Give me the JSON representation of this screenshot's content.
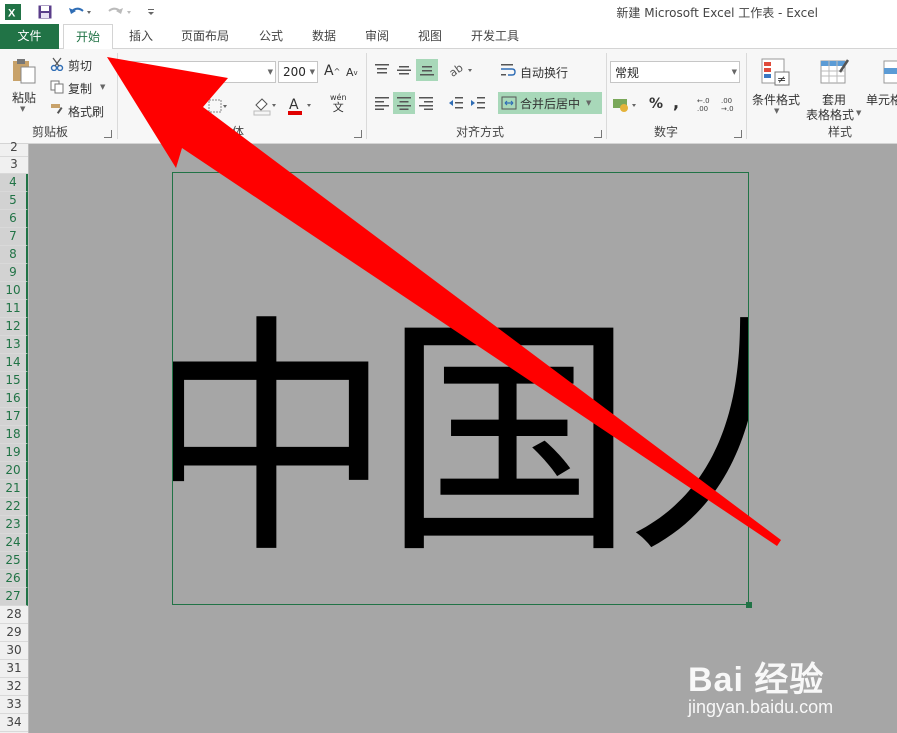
{
  "app": {
    "title": "新建 Microsoft Excel 工作表 - Excel",
    "brand_color": "#217346"
  },
  "tabs": [
    {
      "label": "文件"
    },
    {
      "label": "开始"
    },
    {
      "label": "插入"
    },
    {
      "label": "页面布局"
    },
    {
      "label": "公式"
    },
    {
      "label": "数据"
    },
    {
      "label": "审阅"
    },
    {
      "label": "视图"
    },
    {
      "label": "开发工具"
    }
  ],
  "clipboard": {
    "paste": "粘贴",
    "cut": "剪切",
    "copy": "复制",
    "format_painter": "格式刷",
    "group_label": "剪贴板"
  },
  "font": {
    "size": "200",
    "grow": "A",
    "shrink": "A",
    "phonetic": "wén",
    "phonetic_char": "文",
    "group_label_partial": "体"
  },
  "alignment": {
    "wrap_text": "自动换行",
    "merge_center": "合并后居中",
    "group_label": "对齐方式"
  },
  "number": {
    "format": "常规",
    "percent": "%",
    "comma": ",",
    "group_label": "数字"
  },
  "styles": {
    "conditional": "条件格式",
    "table_line1": "套用",
    "table_line2": "表格格式",
    "cell_partial": "单元格",
    "group_label": "样式"
  },
  "rows": [
    "2",
    "3",
    "4",
    "5",
    "6",
    "7",
    "8",
    "9",
    "10",
    "11",
    "12",
    "13",
    "14",
    "15",
    "16",
    "17",
    "18",
    "19",
    "20",
    "21",
    "22",
    "23",
    "24",
    "25",
    "26",
    "27",
    "28",
    "29",
    "30",
    "31",
    "32",
    "33",
    "34"
  ],
  "picture_text": "中国人",
  "watermark": {
    "brand": "Bai 经验",
    "url": "jingyan.baidu.com"
  },
  "annotation": {
    "arrow_color": "#ff0000"
  }
}
